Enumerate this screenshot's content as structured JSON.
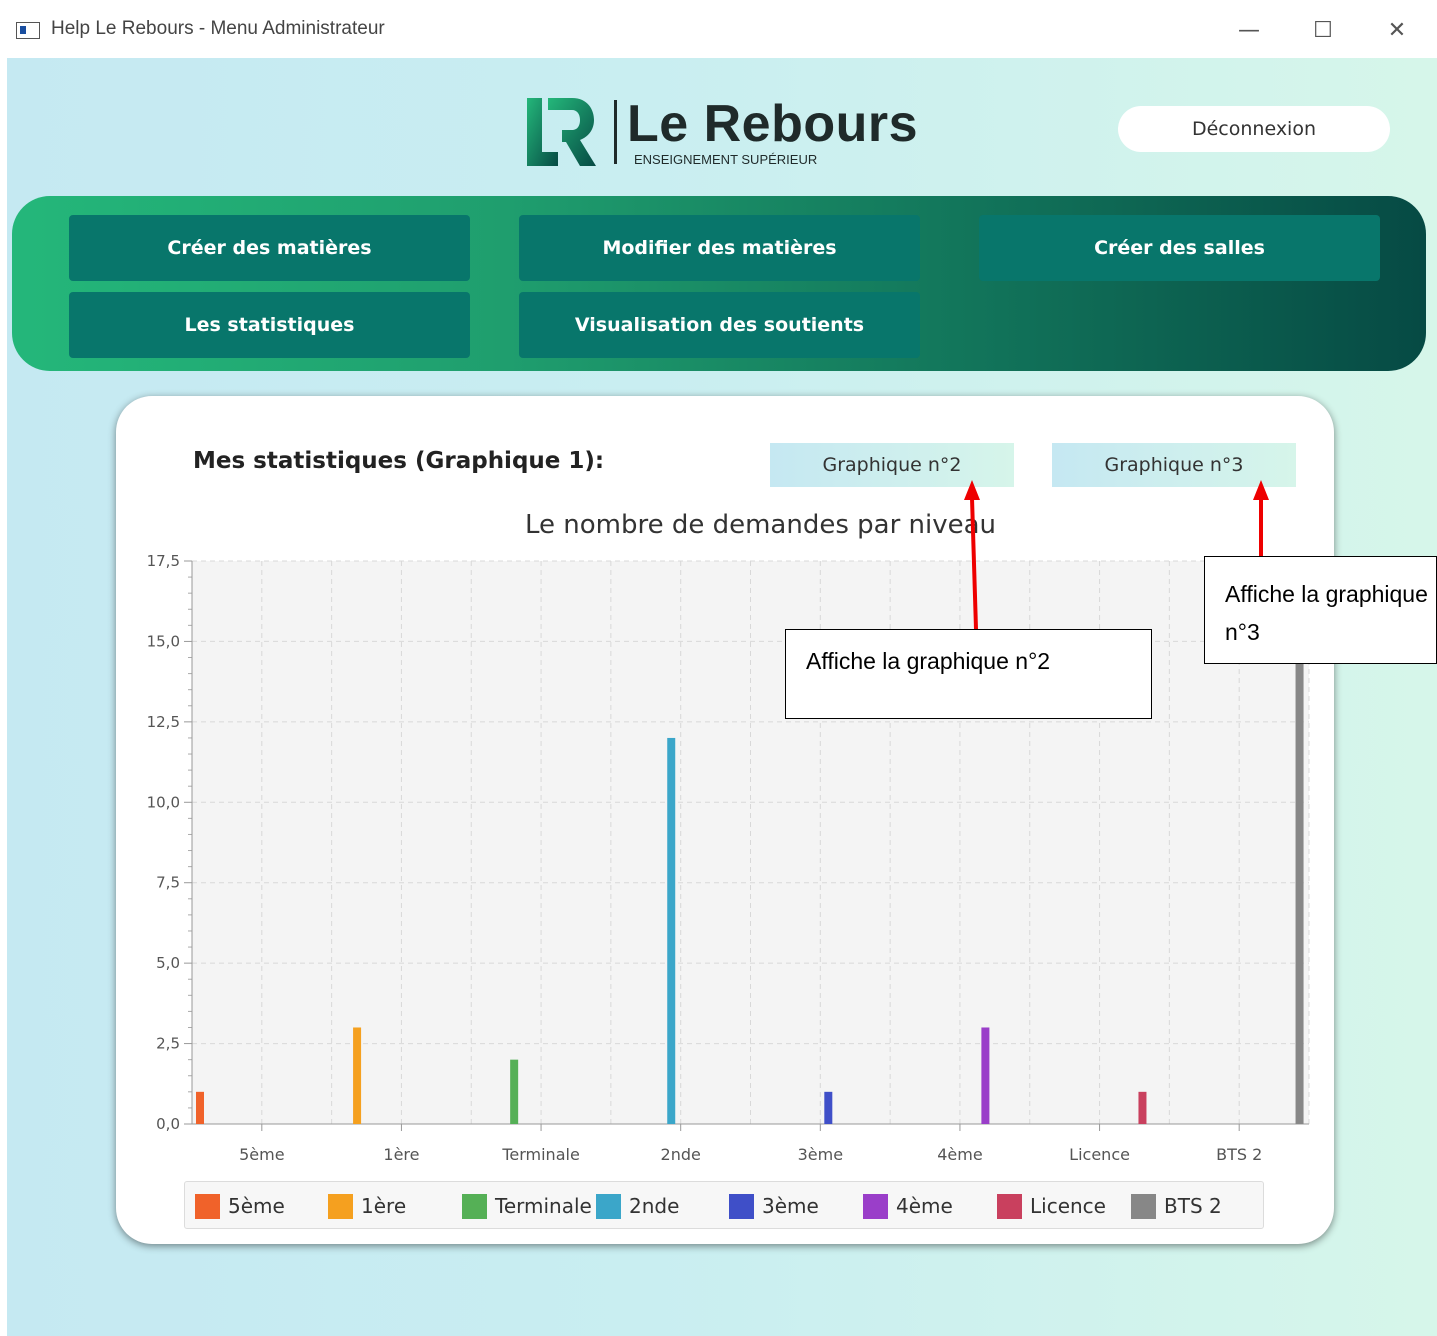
{
  "window": {
    "title": "Help Le Rebours - Menu Administrateur",
    "controls": {
      "minimize": "—",
      "maximize": "☐",
      "close": "✕"
    }
  },
  "brand": {
    "name": "Le Rebours",
    "tagline": "ENSEIGNEMENT SUPÉRIEUR",
    "colors": {
      "primary": "#08766b",
      "dark": "#064a44",
      "light": "#24b77a"
    }
  },
  "header": {
    "logout_label": "Déconnexion"
  },
  "menu": {
    "create_subjects": "Créer des matières",
    "edit_subjects": "Modifier des matières",
    "create_rooms": "Créer des salles",
    "statistics": "Les statistiques",
    "view_support": "Visualisation des soutients"
  },
  "stats": {
    "heading": "Mes statistiques (Graphique 1):",
    "graph2_label": "Graphique n°2",
    "graph3_label": "Graphique n°3"
  },
  "annotations": {
    "graph2": "Affiche la graphique n°2",
    "graph3_line1": "Affiche la graphique",
    "graph3_line2": "n°3"
  },
  "chart_data": {
    "type": "bar",
    "title": "Le nombre de demandes par niveau",
    "xlabel": "",
    "ylabel": "",
    "categories": [
      "5ème",
      "1ère",
      "Terminale",
      "2nde",
      "3ème",
      "4ème",
      "Licence",
      "BTS 2"
    ],
    "series": [
      {
        "name": "5ème",
        "color": "#f0622a",
        "values": [
          1,
          null,
          null,
          null,
          null,
          null,
          null,
          null
        ]
      },
      {
        "name": "1ère",
        "color": "#f5a01f",
        "values": [
          null,
          3,
          null,
          null,
          null,
          null,
          null,
          null
        ]
      },
      {
        "name": "Terminale",
        "color": "#55b056",
        "values": [
          null,
          null,
          2,
          null,
          null,
          null,
          null,
          null
        ]
      },
      {
        "name": "2nde",
        "color": "#3ba6c9",
        "values": [
          null,
          null,
          null,
          12,
          null,
          null,
          null,
          null
        ]
      },
      {
        "name": "3ème",
        "color": "#3f4fc8",
        "values": [
          null,
          null,
          null,
          null,
          1,
          null,
          null,
          null
        ]
      },
      {
        "name": "4ème",
        "color": "#9a3ec9",
        "values": [
          null,
          null,
          null,
          null,
          null,
          3,
          null,
          null
        ]
      },
      {
        "name": "Licence",
        "color": "#c9405e",
        "values": [
          null,
          null,
          null,
          null,
          null,
          null,
          1,
          null
        ]
      },
      {
        "name": "BTS 2",
        "color": "#878787",
        "values": [
          null,
          null,
          null,
          null,
          null,
          null,
          null,
          17
        ]
      }
    ],
    "ylim": [
      0,
      17.5
    ],
    "yticks": [
      "0,0",
      "2,5",
      "5,0",
      "7,5",
      "10,0",
      "12,5",
      "15,0",
      "17,5"
    ],
    "grid": true,
    "legend": "bottom"
  }
}
